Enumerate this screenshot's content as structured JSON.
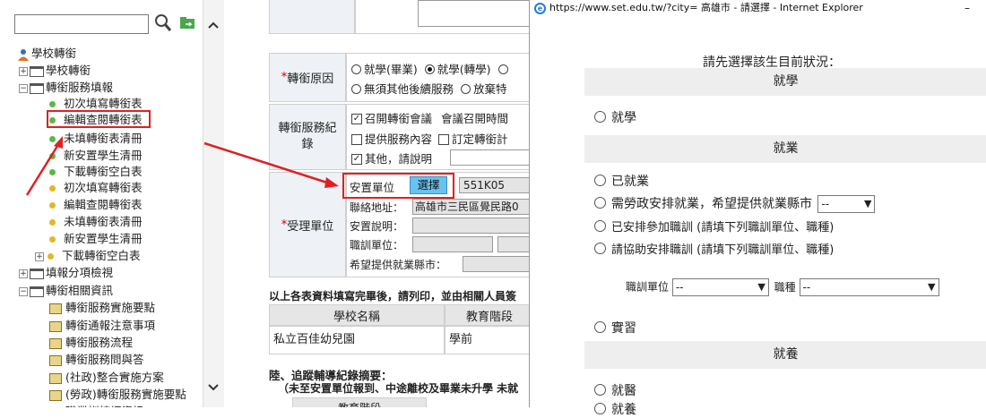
{
  "tree": {
    "search_placeholder": "",
    "nodes": [
      {
        "label": "學校轉銜",
        "indent": 0,
        "icon": "user-icon"
      },
      {
        "label": "學校轉銜",
        "indent": 1,
        "icon": "folder-icon",
        "exp": "+"
      },
      {
        "label": "轉銜服務填報",
        "indent": 1,
        "icon": "folder-icon",
        "exp": "−"
      },
      {
        "label": "初次填寫轉銜表",
        "indent": 2,
        "icon": "green-dot"
      },
      {
        "label": "編輯查閱轉銜表",
        "indent": 2,
        "icon": "green-dot"
      },
      {
        "label": "未填轉銜表清冊",
        "indent": 2,
        "icon": "green-dot"
      },
      {
        "label": "新安置學生清冊",
        "indent": 2,
        "icon": "green-dot"
      },
      {
        "label": "下載轉銜空白表",
        "indent": 2,
        "icon": "green-dot"
      },
      {
        "label": "初次填寫轉銜表",
        "indent": 2,
        "icon": "yellow-dot"
      },
      {
        "label": "編輯查閱轉銜表",
        "indent": 2,
        "icon": "yellow-dot"
      },
      {
        "label": "未填轉銜表清冊",
        "indent": 2,
        "icon": "yellow-dot"
      },
      {
        "label": "新安置學生清冊",
        "indent": 2,
        "icon": "yellow-dot"
      },
      {
        "label": "下載轉銜空白表",
        "indent": 2,
        "icon": "yellow-dot",
        "exp": "+"
      },
      {
        "label": "填報分項檢視",
        "indent": 1,
        "icon": "folder-icon",
        "exp": "+"
      },
      {
        "label": "轉銜相關資訊",
        "indent": 1,
        "icon": "folder-icon",
        "exp": "−"
      },
      {
        "label": "轉銜服務實施要點",
        "indent": 2,
        "icon": "doc-icon"
      },
      {
        "label": "轉銜通報注意事項",
        "indent": 2,
        "icon": "doc-icon"
      },
      {
        "label": "轉銜服務流程",
        "indent": 2,
        "icon": "doc-icon"
      },
      {
        "label": "轉銜服務問與答",
        "indent": 2,
        "icon": "doc-icon"
      },
      {
        "label": "(社政)整合實施方案",
        "indent": 2,
        "icon": "doc-icon"
      },
      {
        "label": "(勞政)轉銜服務實施要點",
        "indent": 2,
        "icon": "doc-icon"
      },
      {
        "label": "職業訓練網資訊",
        "indent": 2,
        "icon": "doc-icon"
      }
    ]
  },
  "form": {
    "reason_label_req": "*",
    "reason_label": "轉銜原因",
    "reason_opt1": "就學(畢業)",
    "reason_opt2": "就學(轉學)",
    "reason_opt3": "無須其他後續服務",
    "reason_opt4": "放棄特",
    "service_label": "轉銜服務紀錄",
    "svc_row1": "召開轉銜會議",
    "svc_row1b": "會議召開時間",
    "svc_row2a": "提供服務內容",
    "svc_row2b": "訂定轉銜計",
    "svc_row3": "其他，請說明",
    "unit_label_req": "*",
    "unit_label": "受理單位",
    "placement_label": "安置單位",
    "select_button": "選擇",
    "placement_code": "551K05",
    "address_label": "聯絡地址：",
    "address_value": "高雄市三民區覺民路0",
    "desc_label": "安置說明：",
    "training_label": "職訓單位：",
    "county_label": "希望提供就業縣市：",
    "print_note": "以上各表資料填寫完畢後，請列印，並由相關人員簽",
    "table_headers": [
      "學校名稱",
      "教育階段"
    ],
    "table_row": [
      "私立百佳幼兒園",
      "學前"
    ],
    "section_title": "陸、追蹤輔導紀錄摘要：",
    "section_sub": "（未至安置單位報到、中途離校及畢業未升學 未就",
    "bottom_header": "教育階段"
  },
  "popup": {
    "title": "https://www.set.edu.tw/?city= 高雄市 - 請選擇 - Internet Explorer",
    "minimize": "–",
    "prompt": "請先選擇該生目前狀況：",
    "sec_study": "就學",
    "opt_study": "就學",
    "sec_employ": "就業",
    "opt_employed": "已就業",
    "opt_need_job": "需勞政安排就業，希望提供就業縣市",
    "county_select": "--",
    "opt_training": "已安排參加職訓 (請填下列職訓單位、職種)",
    "opt_req_training": "請協助安排職訓 (請填下列職訓單位、職種)",
    "training_unit_label": "職訓單位",
    "training_unit_select": "--",
    "job_type_label": "職種",
    "job_type_select": "--",
    "opt_intern": "實習",
    "sec_care": "就養",
    "opt_medical": "就醫",
    "opt_care": "就養"
  },
  "colors": {
    "highlight_border": "#e02020",
    "arrow": "#e02020",
    "select_button_bg": "#69c3f0",
    "required": "#cc0000"
  }
}
